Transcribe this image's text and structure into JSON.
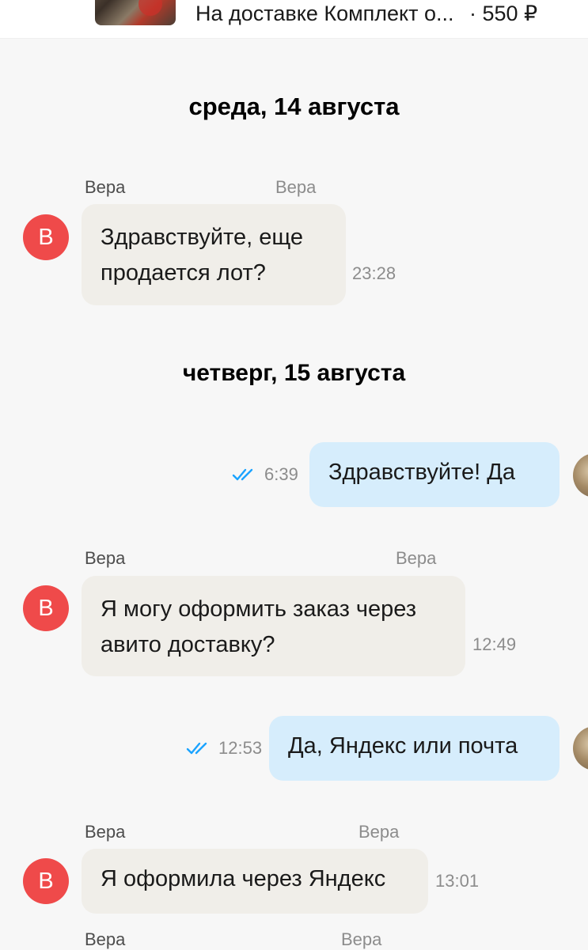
{
  "header": {
    "title": "На доставке Комплект о...",
    "price": "· 550 ₽"
  },
  "messages": [
    {
      "type": "date",
      "text": "среда, 14 августа"
    },
    {
      "type": "in",
      "sender": "Вера",
      "sender_dup": "Вера",
      "avatar_letter": "В",
      "text_lines": [
        "Здравствуйте, еще",
        "продается лот?"
      ],
      "time": "23:28"
    },
    {
      "type": "date",
      "text": "четверг, 15 августа"
    },
    {
      "type": "out",
      "text_lines": [
        "Здравствуйте! Да"
      ],
      "time": "6:39",
      "read": true
    },
    {
      "type": "in",
      "sender": "Вера",
      "sender_dup": "Вера",
      "avatar_letter": "В",
      "text_lines": [
        "Я могу оформить заказ через",
        "авито доставку?"
      ],
      "time": "12:49"
    },
    {
      "type": "out",
      "text_lines": [
        "Да, Яндекс или почта"
      ],
      "time": "12:53",
      "read": true
    },
    {
      "type": "in",
      "sender": "Вера",
      "sender_dup": "Вера",
      "avatar_letter": "В",
      "text_lines": [
        "Я оформила через Яндекс"
      ],
      "time": "13:01"
    },
    {
      "type": "in",
      "sender": "Вера",
      "sender_dup": "Вера"
    }
  ],
  "colors": {
    "incoming_bubble": "#f0eee9",
    "outgoing_bubble": "#d6edfc",
    "avatar": "#ef4a4a",
    "read_check": "#1aa3ff"
  },
  "icons": [
    "back-arrow-icon",
    "double-check-icon"
  ]
}
